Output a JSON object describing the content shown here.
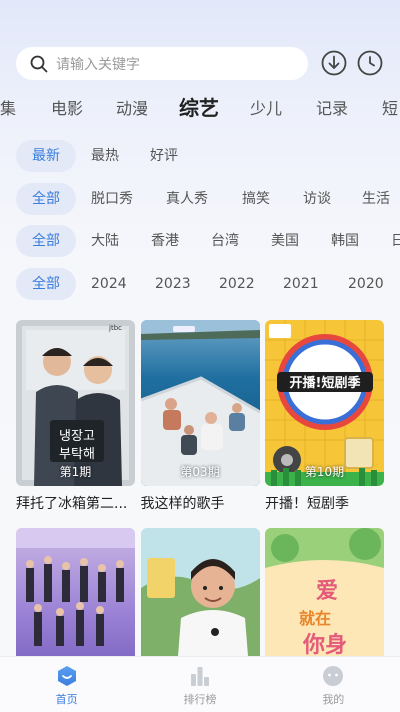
{
  "search": {
    "placeholder": "请输入关键字"
  },
  "top_icons": {
    "download": "download-icon",
    "history": "clock-icon"
  },
  "categories": [
    {
      "label": "集"
    },
    {
      "label": "电影"
    },
    {
      "label": "动漫"
    },
    {
      "label": "综艺",
      "active": true
    },
    {
      "label": "少儿"
    },
    {
      "label": "记录"
    },
    {
      "label": "短"
    }
  ],
  "filters": {
    "sort": [
      "最新",
      "最热",
      "好评"
    ],
    "genre": [
      "全部",
      "脱口秀",
      "真人秀",
      "搞笑",
      "访谈",
      "生活"
    ],
    "region": [
      "全部",
      "大陆",
      "香港",
      "台湾",
      "美国",
      "韩国",
      "日"
    ],
    "year": [
      "全部",
      "2024",
      "2023",
      "2022",
      "2021",
      "2020"
    ]
  },
  "colors": {
    "accent": "#3b7ddd",
    "chip_bg": "#e3e9f6"
  },
  "cards": [
    {
      "title": "拜托了冰箱第二...",
      "episode": "第1期"
    },
    {
      "title": "我这样的歌手",
      "episode": "第03期"
    },
    {
      "title": "开播！短剧季",
      "episode": "第10期"
    },
    {
      "title": "",
      "episode": ""
    },
    {
      "title": "",
      "episode": ""
    },
    {
      "title": "",
      "episode": ""
    }
  ],
  "tabbar": [
    {
      "label": "首页",
      "icon": "home-icon",
      "active": true
    },
    {
      "label": "排行榜",
      "icon": "chart-bars-icon"
    },
    {
      "label": "我的",
      "icon": "profile-face-icon"
    }
  ]
}
